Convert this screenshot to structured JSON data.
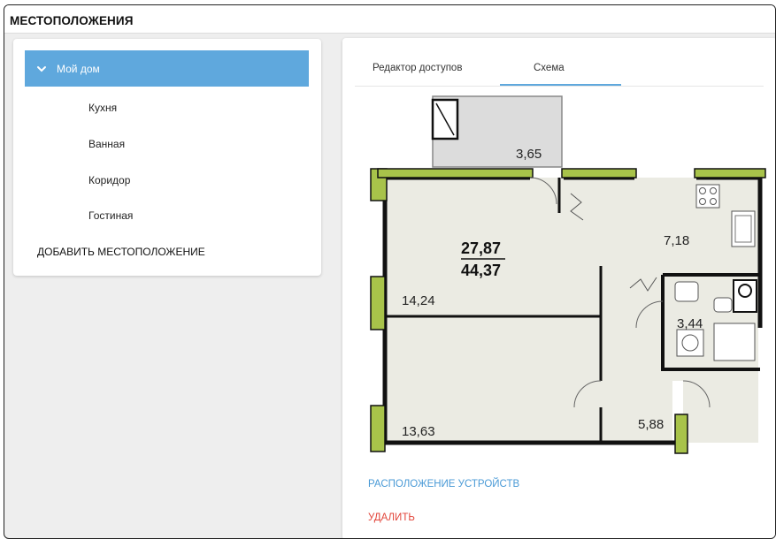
{
  "window": {
    "title": "МЕСТОПОЛОЖЕНИЯ"
  },
  "sidebar": {
    "root": {
      "label": "Мой дом",
      "expanded": true
    },
    "items": [
      {
        "label": "Кухня"
      },
      {
        "label": "Ванная"
      },
      {
        "label": "Коридор"
      },
      {
        "label": "Гостиная"
      }
    ],
    "add_label": "ДОБАВИТЬ МЕСТОПОЛОЖЕНИЕ"
  },
  "tabs": [
    {
      "label": "Редактор доступов",
      "active": false
    },
    {
      "label": "Схема",
      "active": true
    }
  ],
  "plan": {
    "living_area": "27,87",
    "total_area": "44,37",
    "rooms": [
      {
        "area": "3,65"
      },
      {
        "area": "7,18"
      },
      {
        "area": "14,24"
      },
      {
        "area": "3,44"
      },
      {
        "area": "13,63"
      },
      {
        "area": "5,88"
      }
    ]
  },
  "actions": {
    "devices_label": "РАСПОЛОЖЕНИЕ УСТРОЙСТВ",
    "delete_label": "УДАЛИТЬ"
  },
  "colors": {
    "accent": "#5fa8dd",
    "danger": "#e2453a",
    "wall_accent": "#a8c34a",
    "floor_fill": "#ebebe3"
  }
}
